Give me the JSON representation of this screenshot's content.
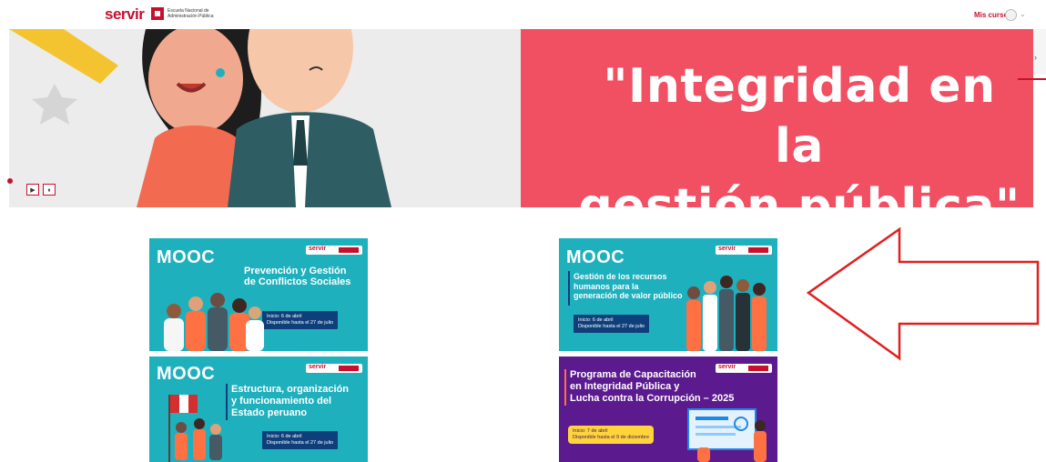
{
  "header": {
    "logo_servir": "servir",
    "logo_enap": "Escuela Nacional de Administración Pública",
    "mis_cursos": "Mis cursos"
  },
  "banner": {
    "headline_line1": "\"Integridad en la",
    "headline_line2": "gestión pública\"",
    "play_icon": "▶",
    "pause_icon": "⏸"
  },
  "cards": [
    {
      "mooc": "MOOC",
      "title_line1": "Prevención y Gestión",
      "title_line2": "de Conflictos Sociales",
      "info_line1": "Inicio: 6 de abril",
      "info_line2": "Disponible hasta el 27 de julio"
    },
    {
      "mooc": "MOOC",
      "title_line1": "Gestión de los recursos",
      "title_line2": "humanos para la",
      "title_line3": "generación de valor público",
      "info_line1": "Inicio: 6 de abril",
      "info_line2": "Disponible hasta el 27 de julio"
    },
    {
      "mooc": "MOOC",
      "title_line1": "Estructura, organización",
      "title_line2": "y funcionamiento del",
      "title_line3": "Estado peruano",
      "info_line1": "Inicio: 6 de abril",
      "info_line2": "Disponible hasta el 27 de julio"
    },
    {
      "title_line1": "Programa de Capacitación",
      "title_line2": "en Integridad Pública y",
      "title_line3": "Lucha contra la Corrupción – 2025",
      "info_line1": "Inicio: 7 de abril",
      "info_line2": "Disponible hasta el 9 de diciembre"
    }
  ],
  "colors": {
    "brand_red": "#c8102e",
    "banner_red": "#f14f62",
    "teal": "#1fb0bd",
    "navy": "#0f3f7a",
    "purple": "#5b1a8e",
    "yellow": "#ffd43b"
  }
}
